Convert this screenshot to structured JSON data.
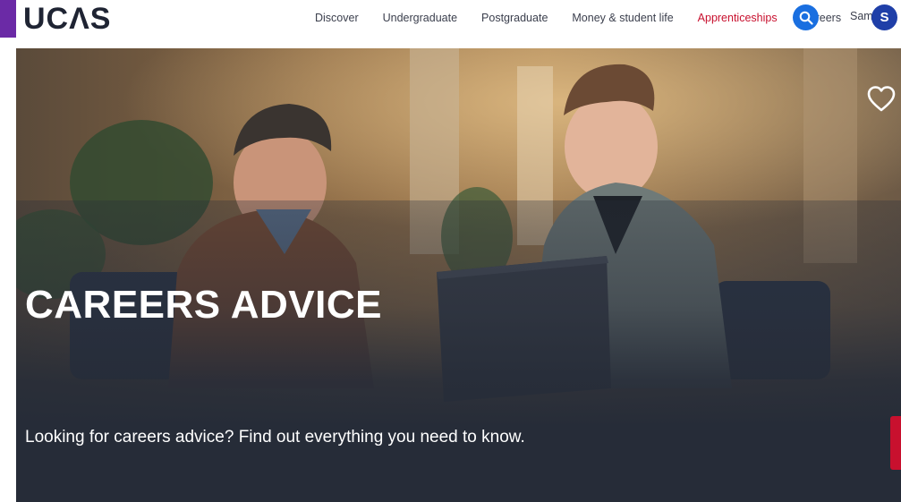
{
  "header": {
    "logo": "UCΛS",
    "nav": [
      {
        "label": "Discover",
        "active": false
      },
      {
        "label": "Undergraduate",
        "active": false
      },
      {
        "label": "Postgraduate",
        "active": false
      },
      {
        "label": "Money & student life",
        "active": false
      },
      {
        "label": "Apprenticeships",
        "active": true
      },
      {
        "label": "Careers",
        "active": false
      }
    ],
    "search_icon": "search-icon",
    "user_name": "Sam",
    "user_initial": "S"
  },
  "hero": {
    "title": "CAREERS ADVICE",
    "subtitle": "Looking for careers advice? Find out everything you need to know.",
    "favourite_icon": "heart-icon"
  },
  "colors": {
    "brand_purple": "#6b2aa6",
    "active_nav": "#c8102e",
    "search_blue": "#1a6fe0",
    "avatar_blue": "#1f3fa8",
    "hero_dark": "#262c38",
    "feedback_red": "#c8102e"
  }
}
